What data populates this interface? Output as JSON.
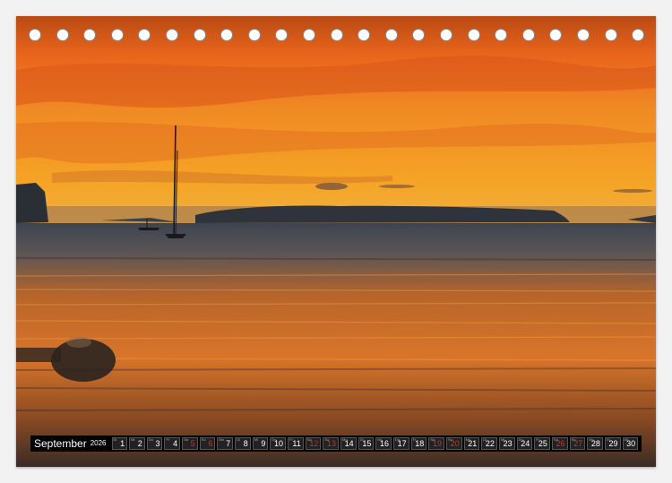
{
  "calendar": {
    "month": "September",
    "year": "2026",
    "days": [
      {
        "n": "1",
        "w": "Di",
        "weekend": false
      },
      {
        "n": "2",
        "w": "Mi",
        "weekend": false
      },
      {
        "n": "3",
        "w": "Do",
        "weekend": false
      },
      {
        "n": "4",
        "w": "Fr",
        "weekend": false
      },
      {
        "n": "5",
        "w": "Sa",
        "weekend": true
      },
      {
        "n": "6",
        "w": "So",
        "weekend": true
      },
      {
        "n": "7",
        "w": "Mo",
        "weekend": false
      },
      {
        "n": "8",
        "w": "Di",
        "weekend": false
      },
      {
        "n": "9",
        "w": "Mi",
        "weekend": false
      },
      {
        "n": "10",
        "w": "Do",
        "weekend": false
      },
      {
        "n": "11",
        "w": "Fr",
        "weekend": false
      },
      {
        "n": "12",
        "w": "Sa",
        "weekend": true
      },
      {
        "n": "13",
        "w": "So",
        "weekend": true
      },
      {
        "n": "14",
        "w": "Mo",
        "weekend": false
      },
      {
        "n": "15",
        "w": "Di",
        "weekend": false
      },
      {
        "n": "16",
        "w": "Mi",
        "weekend": false
      },
      {
        "n": "17",
        "w": "Do",
        "weekend": false
      },
      {
        "n": "18",
        "w": "Fr",
        "weekend": false
      },
      {
        "n": "19",
        "w": "Sa",
        "weekend": true
      },
      {
        "n": "20",
        "w": "So",
        "weekend": true
      },
      {
        "n": "21",
        "w": "Mo",
        "weekend": false
      },
      {
        "n": "22",
        "w": "Di",
        "weekend": false
      },
      {
        "n": "23",
        "w": "Mi",
        "weekend": false
      },
      {
        "n": "24",
        "w": "Do",
        "weekend": false
      },
      {
        "n": "25",
        "w": "Fr",
        "weekend": false
      },
      {
        "n": "26",
        "w": "Sa",
        "weekend": true
      },
      {
        "n": "27",
        "w": "So",
        "weekend": true
      },
      {
        "n": "28",
        "w": "Mo",
        "weekend": false
      },
      {
        "n": "29",
        "w": "Di",
        "weekend": false
      },
      {
        "n": "30",
        "w": "Mi",
        "weekend": false
      }
    ]
  },
  "colors": {
    "sky_top": "#e8641c",
    "sky_mid": "#f39a2a",
    "horizon": "#f6a623",
    "sea_dark": "#3a3c44",
    "weekend": "#c0392b"
  }
}
